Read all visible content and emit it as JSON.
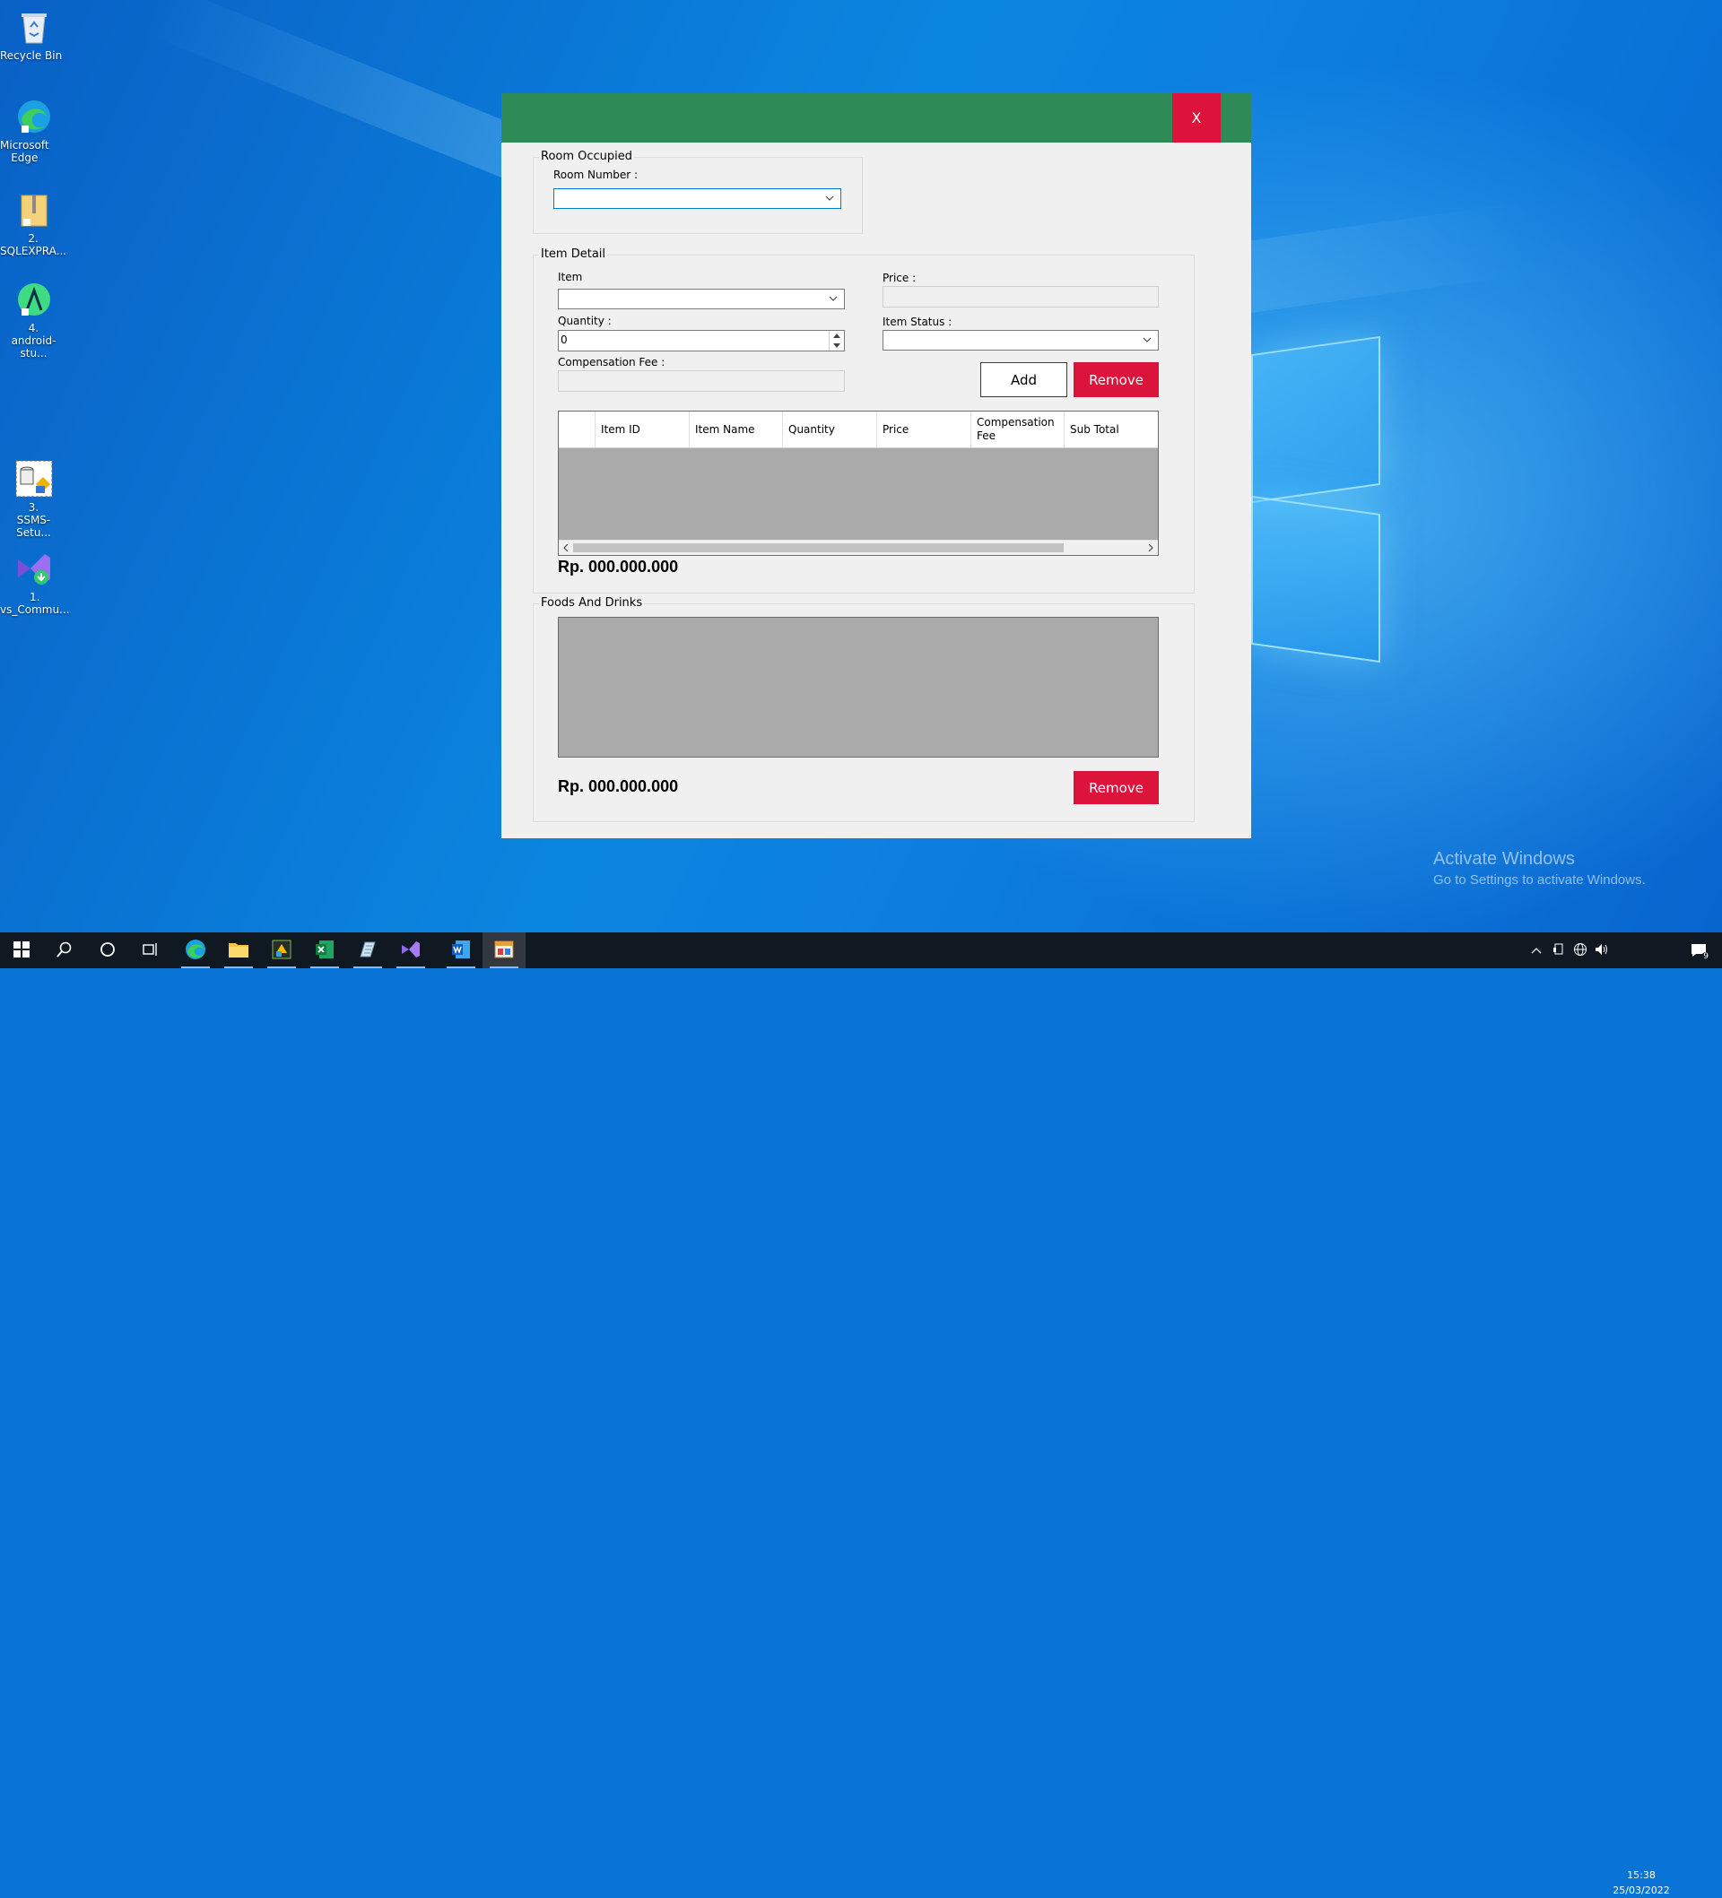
{
  "desktop": {
    "icons": [
      {
        "label": "Recycle Bin",
        "icon": "recycle-bin-icon"
      },
      {
        "label": "Microsoft\nEdge",
        "icon": "edge-icon"
      },
      {
        "label": "2.\nSQLEXPRA...",
        "icon": "zip-folder-icon"
      },
      {
        "label": "4.\nandroid-stu...",
        "icon": "android-studio-icon"
      },
      {
        "label": "3.\nSSMS-Setu...",
        "icon": "ssms-setup-icon"
      },
      {
        "label": "1.\nvs_Commu...",
        "icon": "visual-studio-installer-icon"
      }
    ],
    "watermark": {
      "title": "Activate Windows",
      "subtitle": "Go to Settings to activate Windows."
    }
  },
  "dialog": {
    "close_label": "X",
    "title_color": "#2e8b57",
    "accent_red": "#dc143c",
    "room_group": {
      "title": "Room Occupied",
      "room_number_label": "Room Number :",
      "room_number_value": ""
    },
    "item_group": {
      "title": "Item Detail",
      "item_label": "Item",
      "item_value": "",
      "quantity_label": "Quantity :",
      "quantity_value": "0",
      "comp_fee_label": "Compensation Fee :",
      "price_label": "Price :",
      "status_label": "Item Status :",
      "status_value": "",
      "add_label": "Add",
      "remove_label": "Remove",
      "columns": [
        "",
        "Item ID",
        "Item Name",
        "Quantity",
        "Price",
        "Compensation Fee",
        "Sub Total"
      ],
      "total": "Rp.  000.000.000"
    },
    "food_group": {
      "title": "Foods And Drinks",
      "total": "Rp.  000.000.000",
      "remove_label": "Remove"
    }
  },
  "taskbar": {
    "apps": [
      {
        "name": "edge",
        "icon": "edge-icon"
      },
      {
        "name": "file-explorer",
        "icon": "folder-icon"
      },
      {
        "name": "sql-tool",
        "icon": "sql-tool-icon"
      },
      {
        "name": "excel",
        "icon": "excel-icon"
      },
      {
        "name": "notepad",
        "icon": "notepad-icon"
      },
      {
        "name": "visual-studio",
        "icon": "visual-studio-icon"
      },
      {
        "name": "word",
        "icon": "word-icon"
      },
      {
        "name": "winforms-app",
        "icon": "app-window-icon"
      }
    ],
    "time": "15:38",
    "date": "25/03/2022",
    "notification_count": "9"
  }
}
